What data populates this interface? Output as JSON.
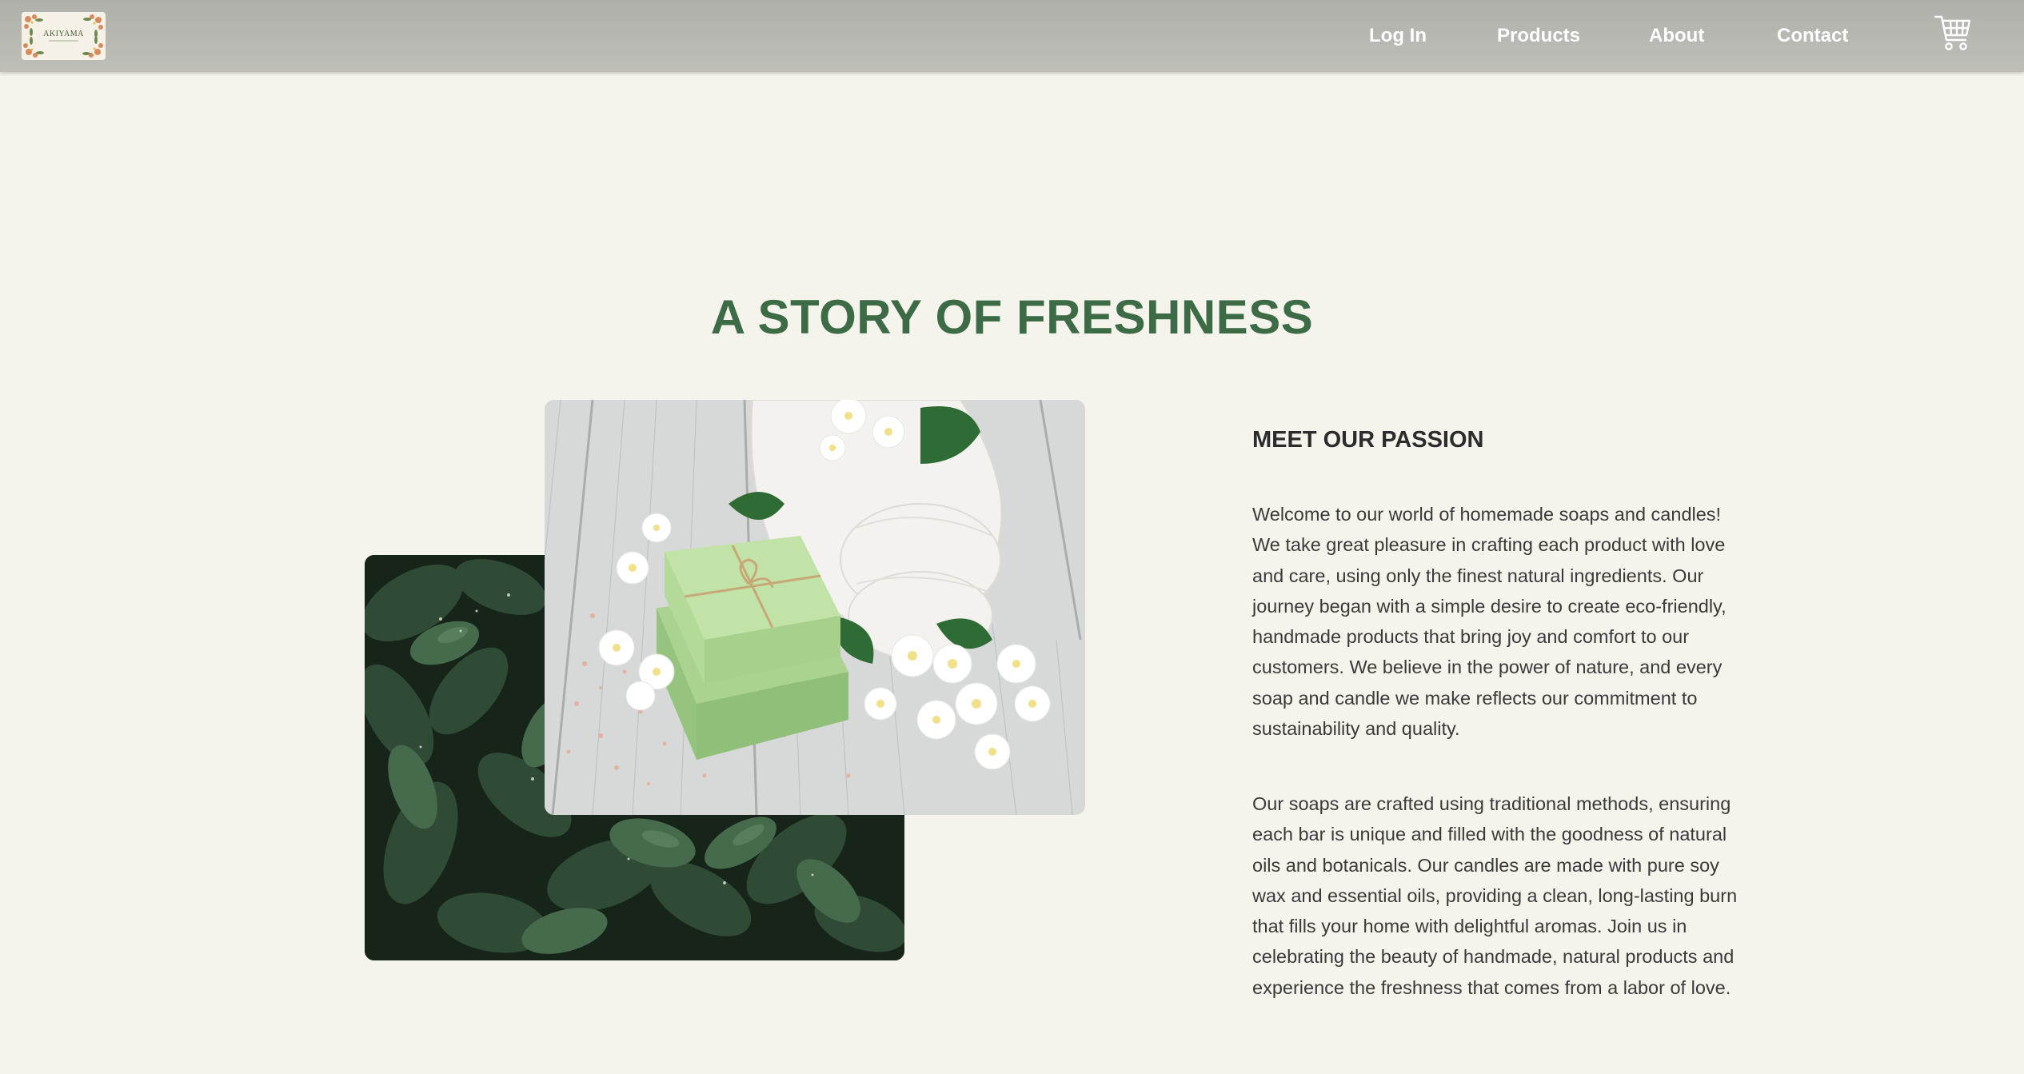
{
  "header": {
    "logo_text": "AKIYAMA",
    "nav": {
      "login": "Log In",
      "products": "Products",
      "about": "About",
      "contact": "Contact"
    },
    "cart_icon": "cart-icon"
  },
  "main": {
    "title": "A STORY OF FRESHNESS",
    "images": {
      "back": "leaves-photo",
      "front": "soap-towels-flowers-photo"
    },
    "section_heading": "MEET OUR PASSION",
    "paragraph_1": "Welcome to our world of homemade soaps and candles! We take great pleasure in crafting each product with love and care, using only the finest natural ingredients. Our journey began with a simple desire to create eco-friendly, handmade products that bring joy and comfort to our customers. We believe in the power of nature, and every soap and candle we make reflects our commitment to sustainability and quality.",
    "paragraph_2": "Our soaps are crafted using traditional methods, ensuring each bar is unique and filled with the goodness of natural oils and botanicals. Our candles are made with pure soy wax and essential oils, providing a clean, long-lasting burn that fills your home with delightful aromas. Join us in celebrating the beauty of handmade, natural products and experience the freshness that comes from a labor of love."
  },
  "colors": {
    "background": "#f5f4ec",
    "header": "#b8b8b2",
    "title": "#3d6b45",
    "text": "#3a3a3a"
  }
}
